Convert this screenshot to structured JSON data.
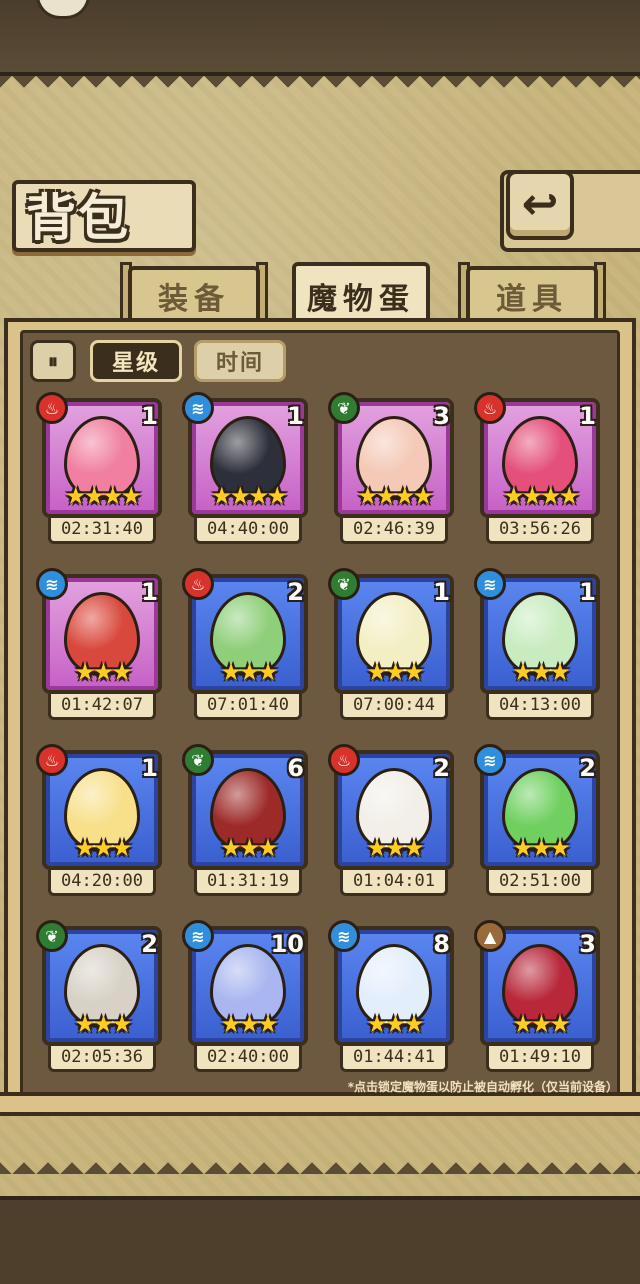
{
  "header": {
    "title": "背包",
    "back_icon": "↩"
  },
  "tabs": [
    {
      "label": "装备",
      "active": false
    },
    {
      "label": "魔物蛋",
      "active": true
    },
    {
      "label": "道具",
      "active": false
    }
  ],
  "sort": {
    "toggle_icon": "⏸",
    "star_label": "星级",
    "time_label": "时间",
    "active": "星级"
  },
  "colors": {
    "fire": "#d8322a",
    "water": "#2f8fdc",
    "wood": "#2e7d32",
    "earth": "#9a6a3a",
    "purple_frame": "#c660c6",
    "blue_frame": "#3a5fcf"
  },
  "eggs": [
    {
      "element": "fire",
      "count": "1",
      "stars": "★★★★",
      "timer": "02:31:40",
      "rarity": "purple",
      "color": "#f07fa0"
    },
    {
      "element": "water",
      "count": "1",
      "stars": "★★★★",
      "timer": "04:40:00",
      "rarity": "purple",
      "color": "#2d2f3a"
    },
    {
      "element": "wood",
      "count": "3",
      "stars": "★★★★",
      "timer": "02:46:39",
      "rarity": "purple",
      "color": "#f4c9b6"
    },
    {
      "element": "fire",
      "count": "1",
      "stars": "★★★★",
      "timer": "03:56:26",
      "rarity": "purple",
      "color": "#e4507a"
    },
    {
      "element": "water",
      "count": "1",
      "stars": "★★★",
      "timer": "01:42:07",
      "rarity": "purple",
      "color": "#d9483c"
    },
    {
      "element": "fire",
      "count": "2",
      "stars": "★★★",
      "timer": "07:01:40",
      "rarity": "blue",
      "color": "#8fcf7a"
    },
    {
      "element": "wood",
      "count": "1",
      "stars": "★★★",
      "timer": "07:00:44",
      "rarity": "blue",
      "color": "#f3efc4"
    },
    {
      "element": "water",
      "count": "1",
      "stars": "★★★",
      "timer": "04:13:00",
      "rarity": "blue",
      "color": "#c8ecc0"
    },
    {
      "element": "fire",
      "count": "1",
      "stars": "★★★",
      "timer": "04:20:00",
      "rarity": "blue",
      "color": "#f8e08a"
    },
    {
      "element": "wood",
      "count": "6",
      "stars": "★★★",
      "timer": "01:31:19",
      "rarity": "blue",
      "color": "#9c2a28"
    },
    {
      "element": "fire",
      "count": "2",
      "stars": "★★★",
      "timer": "01:04:01",
      "rarity": "blue",
      "color": "#f2efe8"
    },
    {
      "element": "water",
      "count": "2",
      "stars": "★★★",
      "timer": "02:51:00",
      "rarity": "blue",
      "color": "#6fd060"
    },
    {
      "element": "wood",
      "count": "2",
      "stars": "★★★",
      "timer": "02:05:36",
      "rarity": "blue",
      "color": "#d8d2c6"
    },
    {
      "element": "water",
      "count": "10",
      "stars": "★★★",
      "timer": "02:40:00",
      "rarity": "blue",
      "color": "#a9b6f0"
    },
    {
      "element": "water",
      "count": "8",
      "stars": "★★★",
      "timer": "01:44:41",
      "rarity": "blue",
      "color": "#e3eefc"
    },
    {
      "element": "earth",
      "count": "3",
      "stars": "★★★",
      "timer": "01:49:10",
      "rarity": "blue",
      "color": "#b8283a"
    }
  ],
  "footnote": "*点击锁定魔物蛋以防止被自动孵化（仅当前设备）"
}
